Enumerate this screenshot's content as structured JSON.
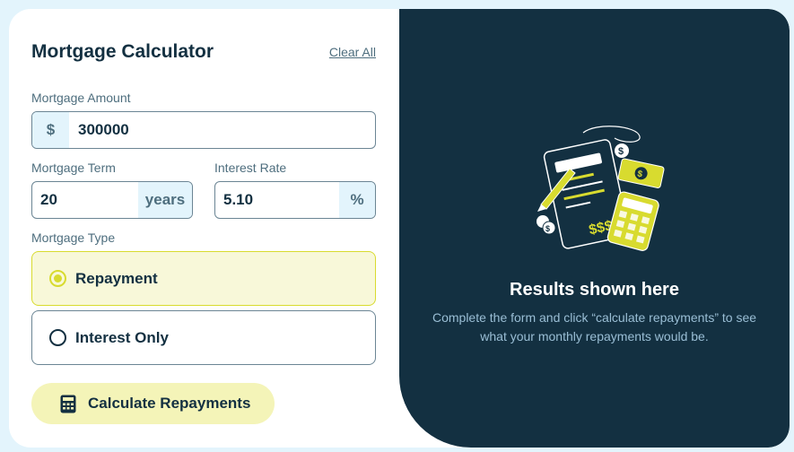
{
  "header": {
    "title": "Mortgage Calculator",
    "clear_label": "Clear All"
  },
  "amount": {
    "label": "Mortgage Amount",
    "prefix": "$",
    "value": "300000"
  },
  "term": {
    "label": "Mortgage Term",
    "value": "20",
    "suffix": "years"
  },
  "rate": {
    "label": "Interest Rate",
    "value": "5.10",
    "suffix": "%"
  },
  "type": {
    "label": "Mortgage Type",
    "options": [
      {
        "label": "Repayment",
        "selected": true
      },
      {
        "label": "Interest Only",
        "selected": false
      }
    ]
  },
  "calculate": {
    "label": "Calculate Repayments",
    "icon": "calculator-icon"
  },
  "results": {
    "title": "Results shown here",
    "description": "Complete the form and click “calculate repayments” to see what your monthly repayments would be."
  },
  "colors": {
    "accent": "#d8db2f",
    "dark": "#133041",
    "slate": "#4e6e7e",
    "light": "#e3f4fc"
  }
}
